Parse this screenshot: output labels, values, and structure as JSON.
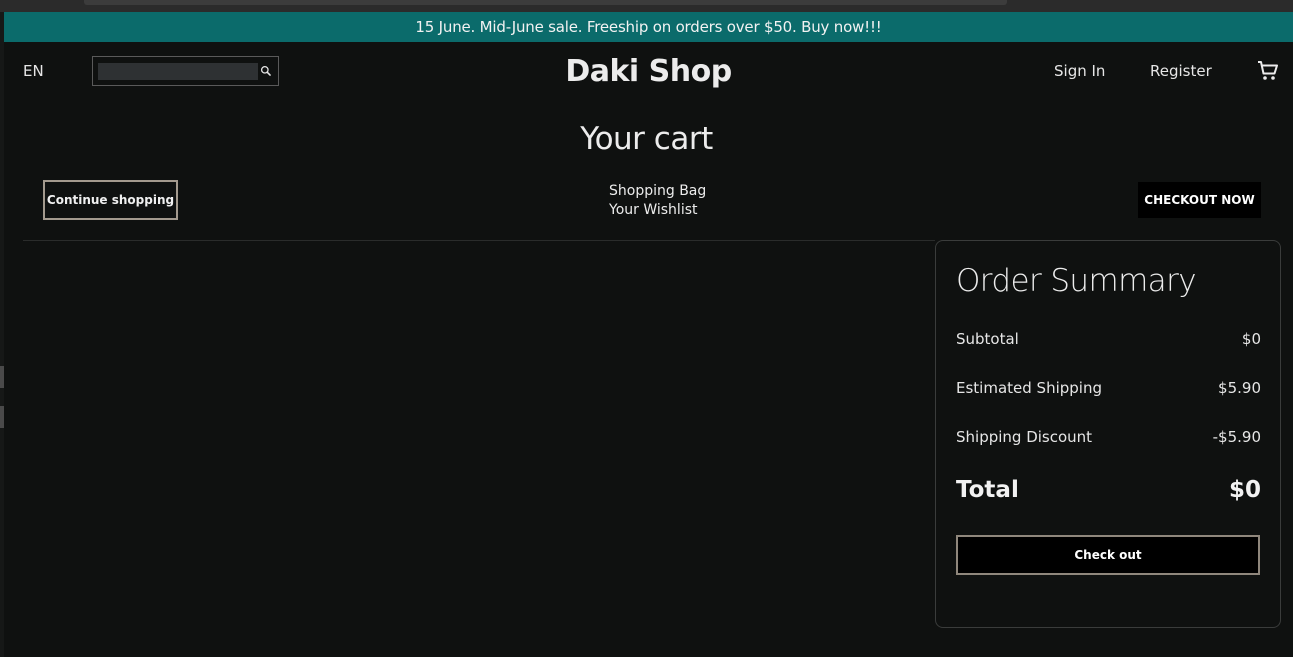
{
  "announcement": {
    "text": "15 June. Mid-June sale. Freeship on orders over $50. Buy now!!!"
  },
  "header": {
    "language": "EN",
    "search": {
      "value": "",
      "placeholder": "",
      "icon": "search-icon"
    },
    "brand": "Daki Shop",
    "sign_in": "Sign In",
    "register": "Register",
    "cart_icon": "shopping-cart-icon"
  },
  "cart": {
    "title": "Your cart",
    "continue_label": "Continue shopping",
    "links": [
      "Shopping Bag",
      "Your Wishlist"
    ],
    "checkout_now_label": "CHECKOUT NOW"
  },
  "summary": {
    "title": "Order Summary",
    "rows": [
      {
        "label": "Subtotal",
        "value": "$0"
      },
      {
        "label": "Estimated Shipping",
        "value": "$5.90"
      },
      {
        "label": "Shipping Discount",
        "value": "-$5.90"
      }
    ],
    "total_label": "Total",
    "total_value": "$0",
    "checkout_label": "Check out"
  },
  "colors": {
    "announcement_bg": "#0b6b6b",
    "page_bg": "#0f1110",
    "button_bg": "#000000",
    "button_border": "#a39a8e"
  }
}
